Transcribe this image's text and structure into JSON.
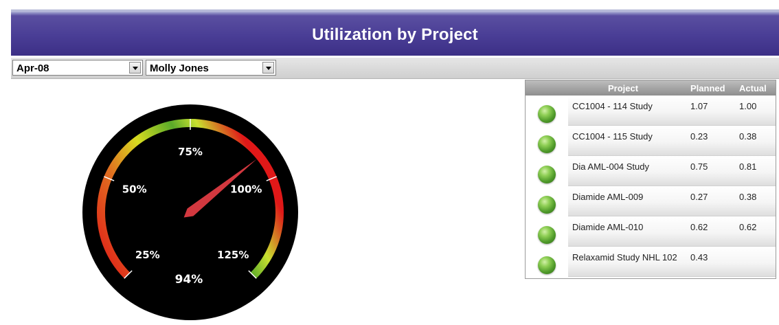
{
  "header": {
    "title": "Utilization by Project"
  },
  "filters": {
    "period": "Apr-08",
    "person": "Molly Jones"
  },
  "gauge": {
    "value_label": "94%",
    "value_percent": 94,
    "scale_min": 25,
    "scale_max": 125,
    "ticks": [
      "25%",
      "50%",
      "75%",
      "100%",
      "125%"
    ],
    "colors": {
      "low": "#e02020",
      "mid": "#d8e020",
      "high": "#4aa02a",
      "needle": "#d2383f"
    }
  },
  "table": {
    "headers": {
      "project": "Project",
      "planned": "Planned",
      "actual": "Actual"
    },
    "rows": [
      {
        "status_icon": "green-ball-icon",
        "project": "CC1004 - 114 Study",
        "planned": "1.07",
        "actual": "1.00"
      },
      {
        "status_icon": "green-ball-icon",
        "project": "CC1004 - 115 Study",
        "planned": "0.23",
        "actual": "0.38"
      },
      {
        "status_icon": "green-ball-icon",
        "project": "Dia AML-004 Study",
        "planned": "0.75",
        "actual": "0.81"
      },
      {
        "status_icon": "green-ball-icon",
        "project": "Diamide AML-009",
        "planned": "0.27",
        "actual": "0.38"
      },
      {
        "status_icon": "green-ball-icon",
        "project": "Diamide AML-010",
        "planned": "0.62",
        "actual": "0.62"
      },
      {
        "status_icon": "green-ball-icon",
        "project": "Relaxamid Study NHL 102",
        "planned": "0.43",
        "actual": ""
      }
    ]
  }
}
